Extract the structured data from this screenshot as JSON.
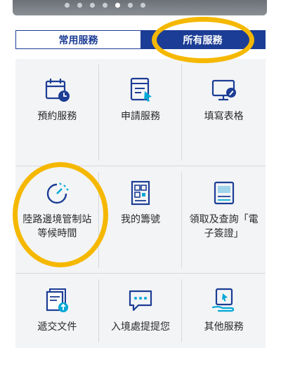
{
  "tabs": [
    {
      "label": "常用服務",
      "active": false
    },
    {
      "label": "所有服務",
      "active": true
    }
  ],
  "services": [
    {
      "label": "預約服務",
      "icon": "calendar-clock-icon"
    },
    {
      "label": "申請服務",
      "icon": "form-click-icon"
    },
    {
      "label": "填寫表格",
      "icon": "monitor-edit-icon"
    },
    {
      "label": "陸路邊境管制站等候時間",
      "icon": "timer-icon"
    },
    {
      "label": "我的籌號",
      "icon": "queue-ticket-icon"
    },
    {
      "label": "領取及查詢「電子簽證」",
      "icon": "e-visa-icon"
    },
    {
      "label": "遞交文件",
      "icon": "document-upload-icon"
    },
    {
      "label": "入境處提提您",
      "icon": "chat-bubble-icon"
    },
    {
      "label": "其他服務",
      "icon": "hand-tablet-icon"
    }
  ],
  "colors": {
    "brand": "#1c3d95",
    "accent": "#00a8d6",
    "highlight": "#f5b800"
  }
}
